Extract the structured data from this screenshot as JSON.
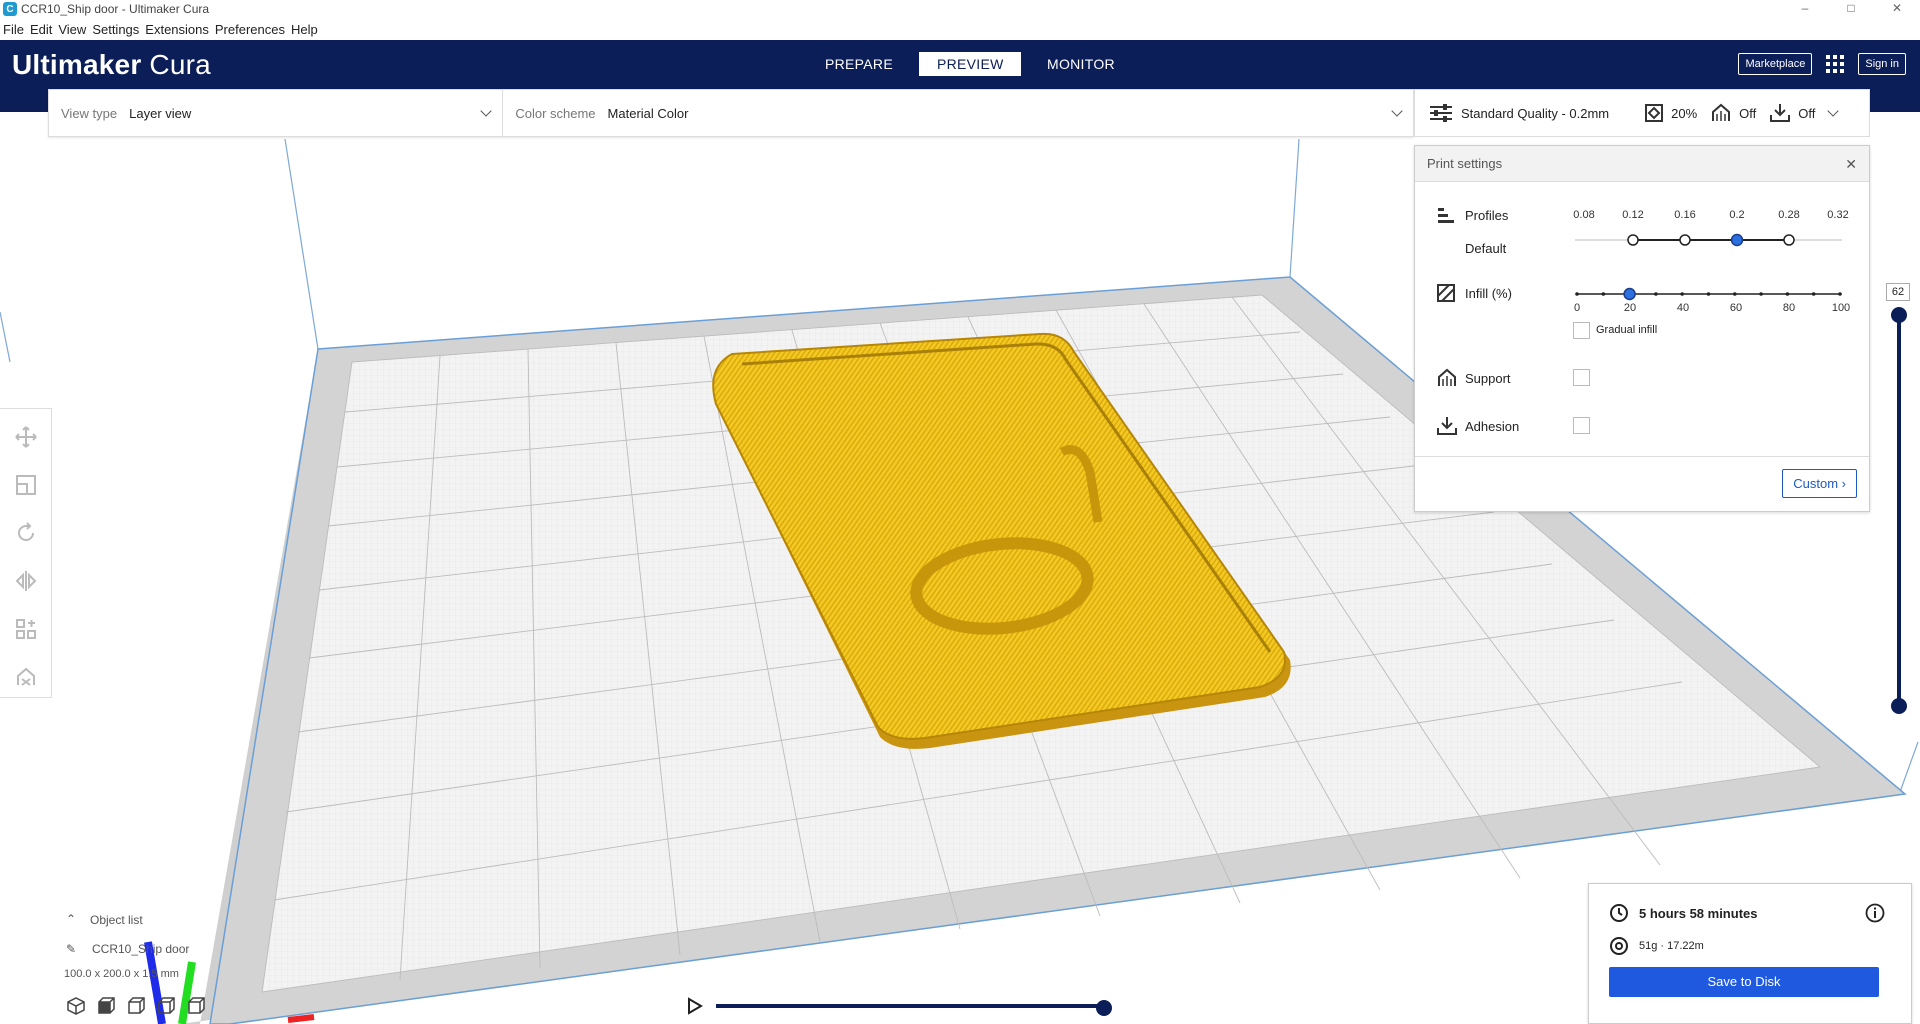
{
  "window": {
    "title": "CCR10_Ship door - Ultimaker Cura",
    "controls": [
      "–",
      "□",
      "✕"
    ]
  },
  "menu": [
    "File",
    "Edit",
    "View",
    "Settings",
    "Extensions",
    "Preferences",
    "Help"
  ],
  "header": {
    "brand_bold": "Ultimaker",
    "brand_light": "Cura",
    "stages": [
      "PREPARE",
      "PREVIEW",
      "MONITOR"
    ],
    "active_stage": "PREVIEW",
    "marketplace": "Marketplace",
    "signin": "Sign in"
  },
  "viewbar": {
    "view_type_label": "View type",
    "view_type_value": "Layer view",
    "color_scheme_label": "Color scheme",
    "color_scheme_value": "Material Color"
  },
  "settingsbar": {
    "profile": "Standard Quality - 0.2mm",
    "infill": "20%",
    "support": "Off",
    "adhesion": "Off"
  },
  "print_settings": {
    "title": "Print settings",
    "close": "✕",
    "profiles_label": "Profiles",
    "default_label": "Default",
    "profile_ticks": [
      "0.08",
      "0.12",
      "0.16",
      "0.2",
      "0.28",
      "0.32"
    ],
    "selected_profile": "0.2",
    "infill_label": "Infill (%)",
    "infill_ticks": [
      "0",
      "20",
      "40",
      "60",
      "80",
      "100"
    ],
    "infill_value": 20,
    "gradual_infill": "Gradual infill",
    "support_label": "Support",
    "adhesion_label": "Adhesion",
    "custom_button": "Custom"
  },
  "layer_slider": {
    "value": "62"
  },
  "object_list": {
    "toggle": "Object list",
    "name": "CCR10_Ship door",
    "dims": "100.0 x 200.0 x 1.5 mm"
  },
  "job": {
    "time": "5 hours 58 minutes",
    "material": "51g · 17.22m",
    "save": "Save to Disk"
  },
  "colors": {
    "header": "#0c1e57",
    "accent": "#1f59e0",
    "model": "#f2c524",
    "grid": "#b8b8b8"
  },
  "icons": [
    "play-icon",
    "clock-icon",
    "spool-icon",
    "info-icon",
    "move-icon",
    "scale-icon",
    "rotate-icon",
    "mirror-icon",
    "per-model-settings-icon",
    "support-blocker-icon"
  ]
}
